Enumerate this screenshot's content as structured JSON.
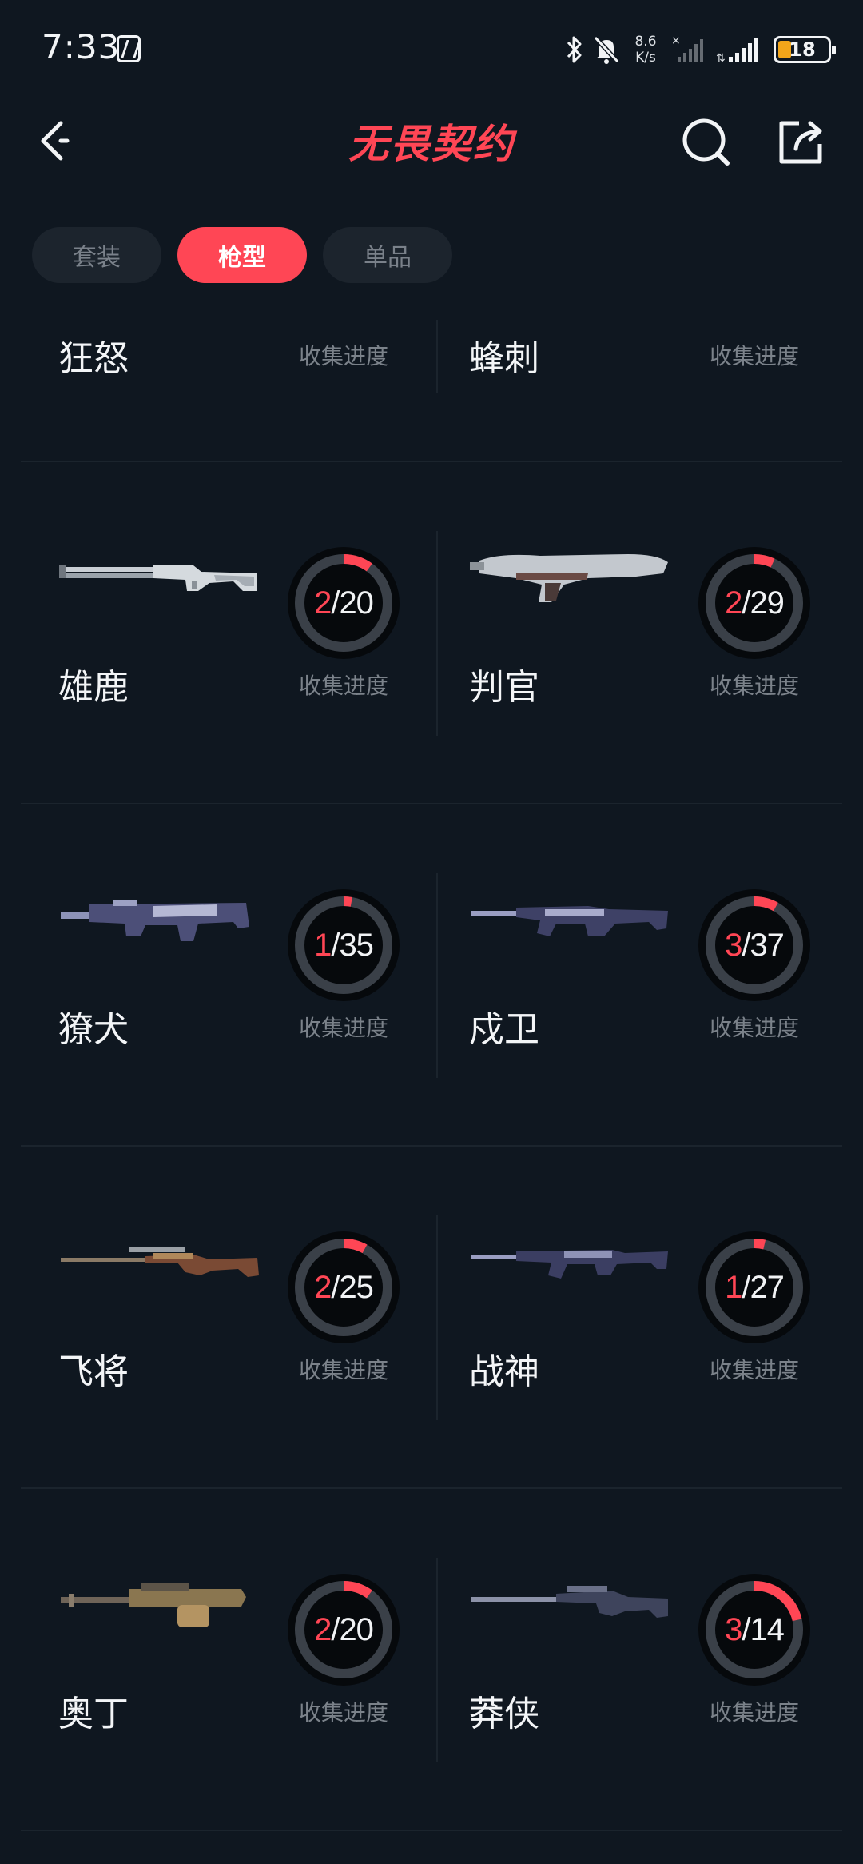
{
  "status_bar": {
    "time": "7:33",
    "net_speed_value": "8.6",
    "net_speed_unit": "K/s",
    "battery": "18"
  },
  "header": {
    "title": "无畏契约",
    "icons": [
      "back-icon",
      "search-icon",
      "share-icon"
    ]
  },
  "tabs": [
    {
      "label": "套装",
      "active": false
    },
    {
      "label": "枪型",
      "active": true
    },
    {
      "label": "单品",
      "active": false
    }
  ],
  "progress_label": "收集进度",
  "items": [
    {
      "name": "狂怒"
    },
    {
      "name": "蜂刺"
    },
    {
      "name": "雄鹿",
      "owned": "2",
      "total": "20"
    },
    {
      "name": "判官",
      "owned": "2",
      "total": "29"
    },
    {
      "name": "獠犬",
      "owned": "1",
      "total": "35"
    },
    {
      "name": "戍卫",
      "owned": "3",
      "total": "37"
    },
    {
      "name": "飞将",
      "owned": "2",
      "total": "25"
    },
    {
      "name": "战神",
      "owned": "1",
      "total": "27"
    },
    {
      "name": "奥丁",
      "owned": "2",
      "total": "20"
    },
    {
      "name": "莽侠",
      "owned": "3",
      "total": "14"
    }
  ],
  "colors": {
    "accent": "#ff4655",
    "background": "#0f1720",
    "ring_track": "#3a4048",
    "muted_text": "#7b828a"
  }
}
